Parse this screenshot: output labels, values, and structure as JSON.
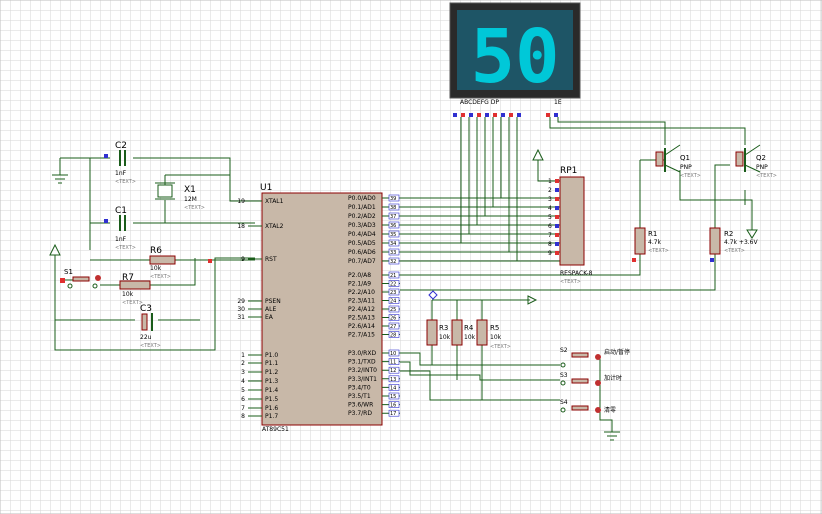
{
  "display": {
    "value": "50",
    "seg_labels": "ABCDEFG  DP",
    "common": "1E",
    "color": "#00c8d8",
    "bg": "#1e5566"
  },
  "mcu": {
    "ref": "U1",
    "part": "AT89C51",
    "left_pins": [
      {
        "num": "19",
        "name": "XTAL1"
      },
      {
        "num": "18",
        "name": "XTAL2"
      },
      {
        "num": "9",
        "name": "RST"
      },
      {
        "num": "29",
        "name": "PSEN"
      },
      {
        "num": "30",
        "name": "ALE"
      },
      {
        "num": "31",
        "name": "EA"
      },
      {
        "num": "1",
        "name": "P1.0"
      },
      {
        "num": "2",
        "name": "P1.1"
      },
      {
        "num": "3",
        "name": "P1.2"
      },
      {
        "num": "4",
        "name": "P1.3"
      },
      {
        "num": "5",
        "name": "P1.4"
      },
      {
        "num": "6",
        "name": "P1.5"
      },
      {
        "num": "7",
        "name": "P1.6"
      },
      {
        "num": "8",
        "name": "P1.7"
      }
    ],
    "right_pins": [
      {
        "num": "39",
        "name": "P0.0/AD0"
      },
      {
        "num": "38",
        "name": "P0.1/AD1"
      },
      {
        "num": "37",
        "name": "P0.2/AD2"
      },
      {
        "num": "36",
        "name": "P0.3/AD3"
      },
      {
        "num": "35",
        "name": "P0.4/AD4"
      },
      {
        "num": "34",
        "name": "P0.5/AD5"
      },
      {
        "num": "33",
        "name": "P0.6/AD6"
      },
      {
        "num": "32",
        "name": "P0.7/AD7"
      },
      {
        "num": "21",
        "name": "P2.0/A8"
      },
      {
        "num": "22",
        "name": "P2.1/A9"
      },
      {
        "num": "23",
        "name": "P2.2/A10"
      },
      {
        "num": "24",
        "name": "P2.3/A11"
      },
      {
        "num": "25",
        "name": "P2.4/A12"
      },
      {
        "num": "26",
        "name": "P2.5/A13"
      },
      {
        "num": "27",
        "name": "P2.6/A14"
      },
      {
        "num": "28",
        "name": "P2.7/A15"
      },
      {
        "num": "10",
        "name": "P3.0/RXD"
      },
      {
        "num": "11",
        "name": "P3.1/TXD"
      },
      {
        "num": "12",
        "name": "P3.2/INT0"
      },
      {
        "num": "13",
        "name": "P3.3/INT1"
      },
      {
        "num": "14",
        "name": "P3.4/T0"
      },
      {
        "num": "15",
        "name": "P3.5/T1"
      },
      {
        "num": "16",
        "name": "P3.6/WR"
      },
      {
        "num": "17",
        "name": "P3.7/RD"
      }
    ]
  },
  "components": {
    "c2": {
      "ref": "C2",
      "value": "1nF"
    },
    "c1": {
      "ref": "C1",
      "value": "1nF"
    },
    "x1": {
      "ref": "X1",
      "value": "12M"
    },
    "r6": {
      "ref": "R6",
      "value": "10k"
    },
    "r7": {
      "ref": "R7",
      "value": "10k"
    },
    "c3": {
      "ref": "C3",
      "value": "22u"
    },
    "s1": {
      "ref": "S1"
    },
    "rp1": {
      "ref": "RP1",
      "part": "RESPACK-8",
      "pins": [
        "1",
        "2",
        "3",
        "4",
        "5",
        "6",
        "7",
        "8",
        "9"
      ]
    },
    "q1": {
      "ref": "Q1",
      "type": "PNP"
    },
    "q2": {
      "ref": "Q2",
      "type": "PNP"
    },
    "r1": {
      "ref": "R1",
      "value": "4.7k"
    },
    "r2": {
      "ref": "R2",
      "value": "4.7k +3.6V"
    },
    "r3": {
      "ref": "R3",
      "value": "10k"
    },
    "r4": {
      "ref": "R4",
      "value": "10k"
    },
    "r5": {
      "ref": "R5",
      "value": "10k"
    },
    "s2": {
      "ref": "S2",
      "label": "启动/暂停"
    },
    "s3": {
      "ref": "S3",
      "label": "加计时"
    },
    "s4": {
      "ref": "S4",
      "label": "清零"
    }
  },
  "placeholder_text": "<TEXT>",
  "colors": {
    "wire": "#1a5c1a",
    "body": "#c8b8a8",
    "outline": "#8b0000",
    "grid": "#d8d8d8",
    "pin_red": "#e03030",
    "pin_blue": "#3030d0"
  }
}
